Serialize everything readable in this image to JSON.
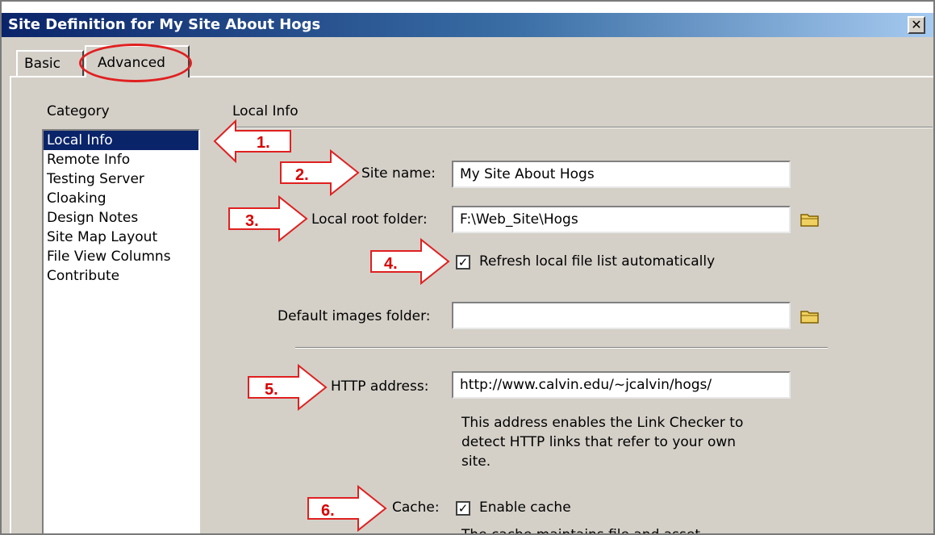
{
  "window": {
    "title": "Site Definition for My Site About Hogs",
    "close_glyph": "✕"
  },
  "tabs": [
    {
      "label": "Basic"
    },
    {
      "label": "Advanced"
    }
  ],
  "category": {
    "heading": "Category",
    "items": [
      "Local Info",
      "Remote Info",
      "Testing Server",
      "Cloaking",
      "Design Notes",
      "Site Map Layout",
      "File View Columns",
      "Contribute"
    ],
    "selected": "Local Info"
  },
  "section": {
    "title": "Local Info"
  },
  "fields": {
    "site_name": {
      "label": "Site name:",
      "value": "My Site About Hogs"
    },
    "local_root": {
      "label": "Local root folder:",
      "value": "F:\\Web_Site\\Hogs"
    },
    "refresh": {
      "label": "Refresh local file list automatically",
      "checked": true
    },
    "default_images": {
      "label": "Default images folder:",
      "value": ""
    },
    "http": {
      "label": "HTTP address:",
      "value": "http://www.calvin.edu/~jcalvin/hogs/"
    },
    "http_help": [
      "This address enables the Link Checker to",
      "detect HTTP links that refer to your own",
      "site."
    ],
    "cache": {
      "label": "Cache:",
      "checkbox_label": "Enable cache",
      "checked": true
    },
    "cache_help_partial": "The cache maintains file and asset"
  },
  "callouts": [
    "1.",
    "2.",
    "3.",
    "4.",
    "5.",
    "6."
  ],
  "colors": {
    "callout": "#e02020",
    "selection": "#0a246a",
    "dialog": "#d4d0c8"
  },
  "icons": {
    "folder": "folder-icon",
    "close": "close-icon",
    "check": "checkmark-icon"
  }
}
